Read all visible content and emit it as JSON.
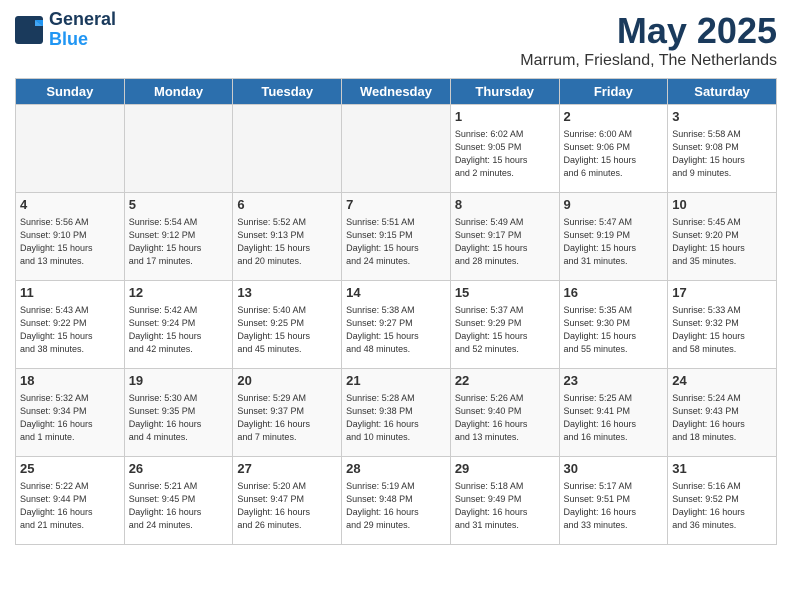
{
  "header": {
    "logo_line1": "General",
    "logo_line2": "Blue",
    "month": "May 2025",
    "location": "Marrum, Friesland, The Netherlands"
  },
  "weekdays": [
    "Sunday",
    "Monday",
    "Tuesday",
    "Wednesday",
    "Thursday",
    "Friday",
    "Saturday"
  ],
  "weeks": [
    [
      {
        "day": "",
        "info": ""
      },
      {
        "day": "",
        "info": ""
      },
      {
        "day": "",
        "info": ""
      },
      {
        "day": "",
        "info": ""
      },
      {
        "day": "1",
        "info": "Sunrise: 6:02 AM\nSunset: 9:05 PM\nDaylight: 15 hours\nand 2 minutes."
      },
      {
        "day": "2",
        "info": "Sunrise: 6:00 AM\nSunset: 9:06 PM\nDaylight: 15 hours\nand 6 minutes."
      },
      {
        "day": "3",
        "info": "Sunrise: 5:58 AM\nSunset: 9:08 PM\nDaylight: 15 hours\nand 9 minutes."
      }
    ],
    [
      {
        "day": "4",
        "info": "Sunrise: 5:56 AM\nSunset: 9:10 PM\nDaylight: 15 hours\nand 13 minutes."
      },
      {
        "day": "5",
        "info": "Sunrise: 5:54 AM\nSunset: 9:12 PM\nDaylight: 15 hours\nand 17 minutes."
      },
      {
        "day": "6",
        "info": "Sunrise: 5:52 AM\nSunset: 9:13 PM\nDaylight: 15 hours\nand 20 minutes."
      },
      {
        "day": "7",
        "info": "Sunrise: 5:51 AM\nSunset: 9:15 PM\nDaylight: 15 hours\nand 24 minutes."
      },
      {
        "day": "8",
        "info": "Sunrise: 5:49 AM\nSunset: 9:17 PM\nDaylight: 15 hours\nand 28 minutes."
      },
      {
        "day": "9",
        "info": "Sunrise: 5:47 AM\nSunset: 9:19 PM\nDaylight: 15 hours\nand 31 minutes."
      },
      {
        "day": "10",
        "info": "Sunrise: 5:45 AM\nSunset: 9:20 PM\nDaylight: 15 hours\nand 35 minutes."
      }
    ],
    [
      {
        "day": "11",
        "info": "Sunrise: 5:43 AM\nSunset: 9:22 PM\nDaylight: 15 hours\nand 38 minutes."
      },
      {
        "day": "12",
        "info": "Sunrise: 5:42 AM\nSunset: 9:24 PM\nDaylight: 15 hours\nand 42 minutes."
      },
      {
        "day": "13",
        "info": "Sunrise: 5:40 AM\nSunset: 9:25 PM\nDaylight: 15 hours\nand 45 minutes."
      },
      {
        "day": "14",
        "info": "Sunrise: 5:38 AM\nSunset: 9:27 PM\nDaylight: 15 hours\nand 48 minutes."
      },
      {
        "day": "15",
        "info": "Sunrise: 5:37 AM\nSunset: 9:29 PM\nDaylight: 15 hours\nand 52 minutes."
      },
      {
        "day": "16",
        "info": "Sunrise: 5:35 AM\nSunset: 9:30 PM\nDaylight: 15 hours\nand 55 minutes."
      },
      {
        "day": "17",
        "info": "Sunrise: 5:33 AM\nSunset: 9:32 PM\nDaylight: 15 hours\nand 58 minutes."
      }
    ],
    [
      {
        "day": "18",
        "info": "Sunrise: 5:32 AM\nSunset: 9:34 PM\nDaylight: 16 hours\nand 1 minute."
      },
      {
        "day": "19",
        "info": "Sunrise: 5:30 AM\nSunset: 9:35 PM\nDaylight: 16 hours\nand 4 minutes."
      },
      {
        "day": "20",
        "info": "Sunrise: 5:29 AM\nSunset: 9:37 PM\nDaylight: 16 hours\nand 7 minutes."
      },
      {
        "day": "21",
        "info": "Sunrise: 5:28 AM\nSunset: 9:38 PM\nDaylight: 16 hours\nand 10 minutes."
      },
      {
        "day": "22",
        "info": "Sunrise: 5:26 AM\nSunset: 9:40 PM\nDaylight: 16 hours\nand 13 minutes."
      },
      {
        "day": "23",
        "info": "Sunrise: 5:25 AM\nSunset: 9:41 PM\nDaylight: 16 hours\nand 16 minutes."
      },
      {
        "day": "24",
        "info": "Sunrise: 5:24 AM\nSunset: 9:43 PM\nDaylight: 16 hours\nand 18 minutes."
      }
    ],
    [
      {
        "day": "25",
        "info": "Sunrise: 5:22 AM\nSunset: 9:44 PM\nDaylight: 16 hours\nand 21 minutes."
      },
      {
        "day": "26",
        "info": "Sunrise: 5:21 AM\nSunset: 9:45 PM\nDaylight: 16 hours\nand 24 minutes."
      },
      {
        "day": "27",
        "info": "Sunrise: 5:20 AM\nSunset: 9:47 PM\nDaylight: 16 hours\nand 26 minutes."
      },
      {
        "day": "28",
        "info": "Sunrise: 5:19 AM\nSunset: 9:48 PM\nDaylight: 16 hours\nand 29 minutes."
      },
      {
        "day": "29",
        "info": "Sunrise: 5:18 AM\nSunset: 9:49 PM\nDaylight: 16 hours\nand 31 minutes."
      },
      {
        "day": "30",
        "info": "Sunrise: 5:17 AM\nSunset: 9:51 PM\nDaylight: 16 hours\nand 33 minutes."
      },
      {
        "day": "31",
        "info": "Sunrise: 5:16 AM\nSunset: 9:52 PM\nDaylight: 16 hours\nand 36 minutes."
      }
    ]
  ]
}
